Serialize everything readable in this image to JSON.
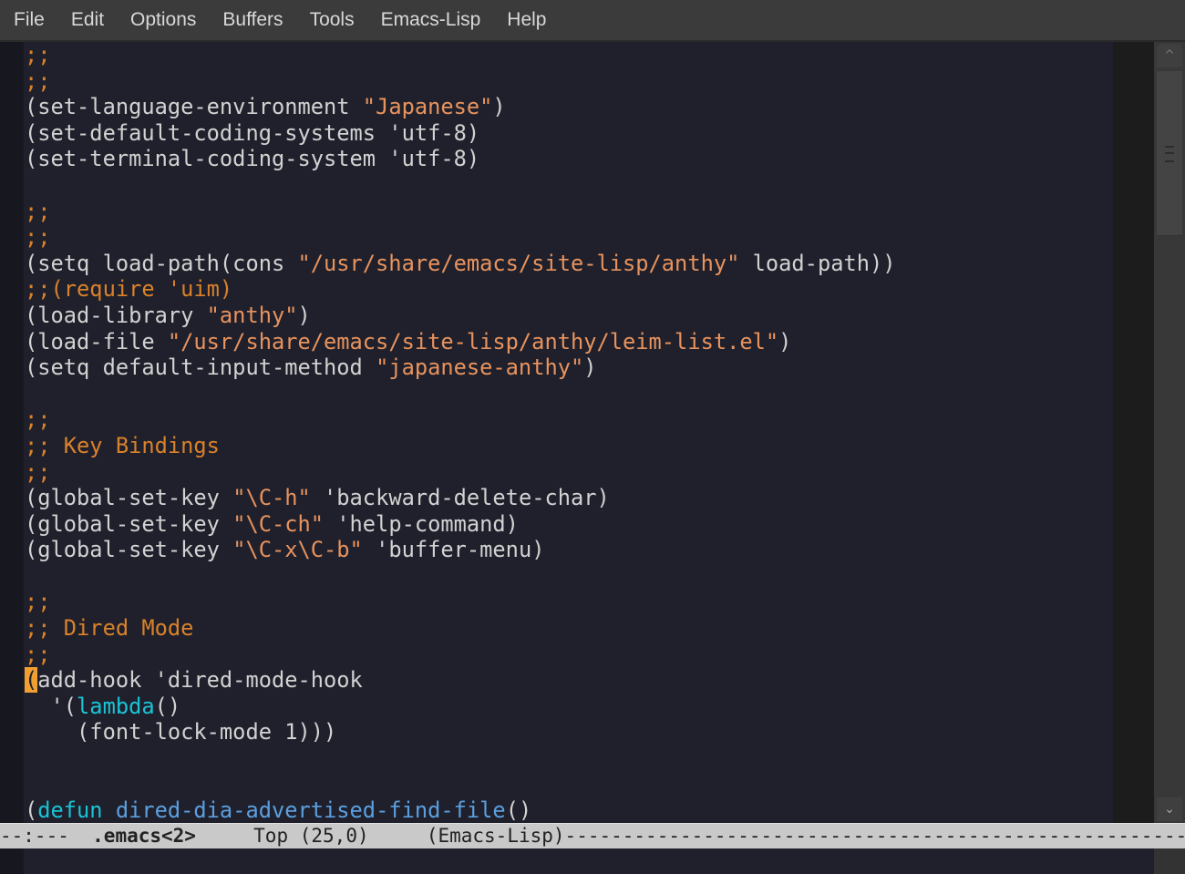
{
  "menu": [
    "File",
    "Edit",
    "Options",
    "Buffers",
    "Tools",
    "Emacs-Lisp",
    "Help"
  ],
  "code_lines": [
    [
      [
        ";;",
        "c"
      ]
    ],
    [
      [
        ";;",
        "c"
      ]
    ],
    [
      [
        "(set-language-environment ",
        ""
      ],
      [
        "\"Japanese\"",
        "s"
      ],
      [
        ")",
        ""
      ]
    ],
    [
      [
        "(set-default-coding-systems 'utf-8)",
        ""
      ]
    ],
    [
      [
        "(set-terminal-coding-system 'utf-8)",
        ""
      ]
    ],
    [],
    [
      [
        ";;",
        "c"
      ]
    ],
    [
      [
        ";;",
        "c"
      ]
    ],
    [
      [
        "(setq load-path(cons ",
        ""
      ],
      [
        "\"/usr/share/emacs/site-lisp/anthy\"",
        "s"
      ],
      [
        " load-path))",
        ""
      ]
    ],
    [
      [
        ";;(require 'uim)",
        "c"
      ]
    ],
    [
      [
        "(load-library ",
        ""
      ],
      [
        "\"anthy\"",
        "s"
      ],
      [
        ")",
        ""
      ]
    ],
    [
      [
        "(load-file ",
        ""
      ],
      [
        "\"/usr/share/emacs/site-lisp/anthy/leim-list.el\"",
        "s"
      ],
      [
        ")",
        ""
      ]
    ],
    [
      [
        "(setq default-input-method ",
        ""
      ],
      [
        "\"japanese-anthy\"",
        "s"
      ],
      [
        ")",
        ""
      ]
    ],
    [],
    [
      [
        ";;",
        "c"
      ]
    ],
    [
      [
        ";; Key Bindings",
        "c"
      ]
    ],
    [
      [
        ";;",
        "c"
      ]
    ],
    [
      [
        "(global-set-key ",
        ""
      ],
      [
        "\"\\C-h\"",
        "s"
      ],
      [
        " 'backward-delete-char)",
        ""
      ]
    ],
    [
      [
        "(global-set-key ",
        ""
      ],
      [
        "\"\\C-ch\"",
        "s"
      ],
      [
        " 'help-command)",
        ""
      ]
    ],
    [
      [
        "(global-set-key ",
        ""
      ],
      [
        "\"\\C-x\\C-b\"",
        "s"
      ],
      [
        " 'buffer-menu)",
        ""
      ]
    ],
    [],
    [
      [
        ";;",
        "c"
      ]
    ],
    [
      [
        ";; Dired Mode",
        "c"
      ]
    ],
    [
      [
        ";;",
        "c"
      ]
    ],
    [
      [
        "(",
        "cur"
      ],
      [
        "add-hook 'dired-mode-hook",
        ""
      ]
    ],
    [
      [
        "  '(",
        ""
      ],
      [
        "lambda",
        "k"
      ],
      [
        "()",
        ""
      ]
    ],
    [
      [
        "    (font-lock-mode 1)))",
        ""
      ]
    ],
    [],
    [],
    [
      [
        "(",
        ""
      ],
      [
        "defun",
        "k"
      ],
      [
        " ",
        ""
      ],
      [
        "dired-dia-advertised-find-file",
        "f"
      ],
      [
        "()",
        ""
      ]
    ]
  ],
  "modeline": {
    "status": "--:---  ",
    "buffer": ".emacs<2>",
    "position": "     Top (25,0)     ",
    "mode": "(Emacs-Lisp)",
    "fill": "------------------------------------------------------------"
  },
  "colors": {
    "background": "#1f202b",
    "comment": "#d9822b",
    "string": "#e8935e",
    "keyword": "#19c3d6",
    "function": "#5c9fe0",
    "cursor": "#f0a030"
  }
}
